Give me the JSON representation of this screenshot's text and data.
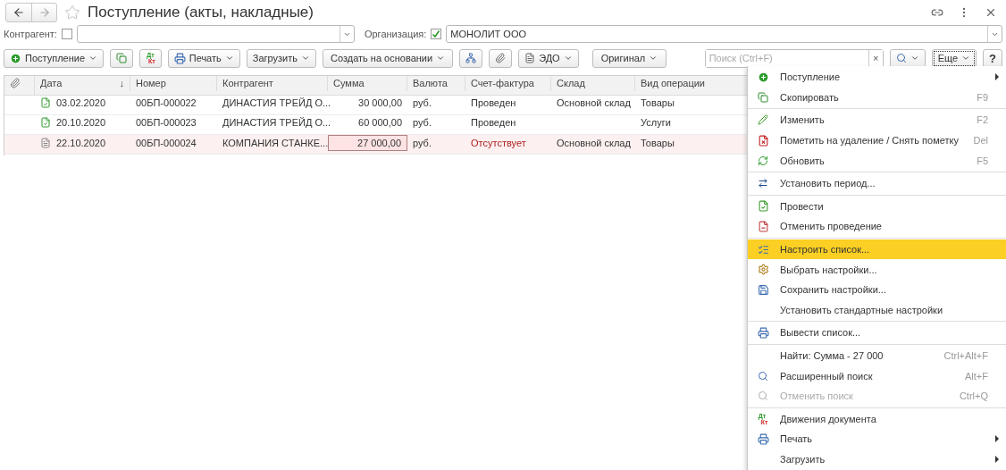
{
  "window": {
    "title": "Поступление (акты, накладные)",
    "favorite": false
  },
  "filters": {
    "counterparty": {
      "label": "Контрагент:",
      "checked": false
    },
    "organization": {
      "label": "Организация:",
      "checked": true,
      "value": "МОНОЛИТ ООО"
    }
  },
  "toolbar": {
    "create": "Поступление",
    "dtkt": {
      "top": "Дт",
      "bottom": "Кт"
    },
    "print": "Печать",
    "load": "Загрузить",
    "based_on": "Создать на основании",
    "edo": "ЭДО",
    "original": "Оригинал",
    "search": {
      "placeholder": "Поиск (Ctrl+F)",
      "clear": "×"
    },
    "more": "Еще",
    "help": "?"
  },
  "table": {
    "columns": [
      "Дата",
      "Номер",
      "Контрагент",
      "Сумма",
      "Валюта",
      "Счет-фактура",
      "Склад",
      "Вид операции"
    ],
    "sort_mark": "↓",
    "rows": [
      {
        "posted": true,
        "selected": false,
        "cells": [
          "03.02.2020",
          "00БП-000022",
          "ДИНАСТИЯ ТРЕЙД О...",
          "30 000,00",
          "руб.",
          "Проведен",
          "Основной склад",
          "Товары"
        ],
        "invoice_missing": false
      },
      {
        "posted": true,
        "selected": false,
        "cells": [
          "20.10.2020",
          "00БП-000023",
          "ДИНАСТИЯ ТРЕЙД О...",
          "60 000,00",
          "руб.",
          "Проведен",
          "",
          "Услуги"
        ],
        "invoice_missing": false
      },
      {
        "posted": false,
        "selected": true,
        "cells": [
          "22.10.2020",
          "00БП-000024",
          "КОМПАНИЯ СТАНКЕ...",
          "27 000,00",
          "руб.",
          "Отсутствует",
          "Основной склад",
          "Товары"
        ],
        "invoice_missing": true
      }
    ]
  },
  "menu": {
    "groups": [
      [
        {
          "label": "Поступление",
          "submenu": true,
          "disabled": false,
          "selected": false
        },
        {
          "label": "Скопировать",
          "shortcut": "F9",
          "submenu": false,
          "disabled": false,
          "selected": false
        }
      ],
      [
        {
          "label": "Изменить",
          "shortcut": "F2",
          "submenu": false,
          "disabled": false,
          "selected": false
        },
        {
          "label": "Пометить на удаление / Снять пометку",
          "shortcut": "Del",
          "submenu": false,
          "disabled": false,
          "selected": false
        },
        {
          "label": "Обновить",
          "shortcut": "F5",
          "submenu": false,
          "disabled": false,
          "selected": false
        }
      ],
      [
        {
          "label": "Установить период...",
          "submenu": false,
          "disabled": false,
          "selected": false
        }
      ],
      [
        {
          "label": "Провести",
          "submenu": false,
          "disabled": false,
          "selected": false
        },
        {
          "label": "Отменить проведение",
          "submenu": false,
          "disabled": false,
          "selected": false
        }
      ],
      [
        {
          "label": "Настроить список...",
          "submenu": false,
          "disabled": false,
          "selected": true
        },
        {
          "label": "Выбрать настройки...",
          "submenu": false,
          "disabled": false,
          "selected": false
        },
        {
          "label": "Сохранить настройки...",
          "submenu": false,
          "disabled": false,
          "selected": false
        },
        {
          "label": "Установить стандартные настройки",
          "submenu": false,
          "disabled": false,
          "selected": false
        }
      ],
      [
        {
          "label": "Вывести список...",
          "submenu": false,
          "disabled": false,
          "selected": false
        }
      ],
      [
        {
          "label": "Найти: Сумма - 27 000",
          "shortcut": "Ctrl+Alt+F",
          "submenu": false,
          "disabled": false,
          "selected": false
        },
        {
          "label": "Расширенный поиск",
          "shortcut": "Alt+F",
          "submenu": false,
          "disabled": false,
          "selected": false
        },
        {
          "label": "Отменить поиск",
          "shortcut": "Ctrl+Q",
          "submenu": false,
          "disabled": true,
          "selected": false
        }
      ],
      [
        {
          "label": "Движения документа",
          "icon_text": {
            "top": "Дт",
            "bottom": "Кт"
          },
          "submenu": false,
          "disabled": false,
          "selected": false
        },
        {
          "label": "Печать",
          "submenu": true,
          "disabled": false,
          "selected": false
        },
        {
          "label": "Загрузить",
          "submenu": true,
          "disabled": false,
          "selected": false
        }
      ]
    ]
  }
}
